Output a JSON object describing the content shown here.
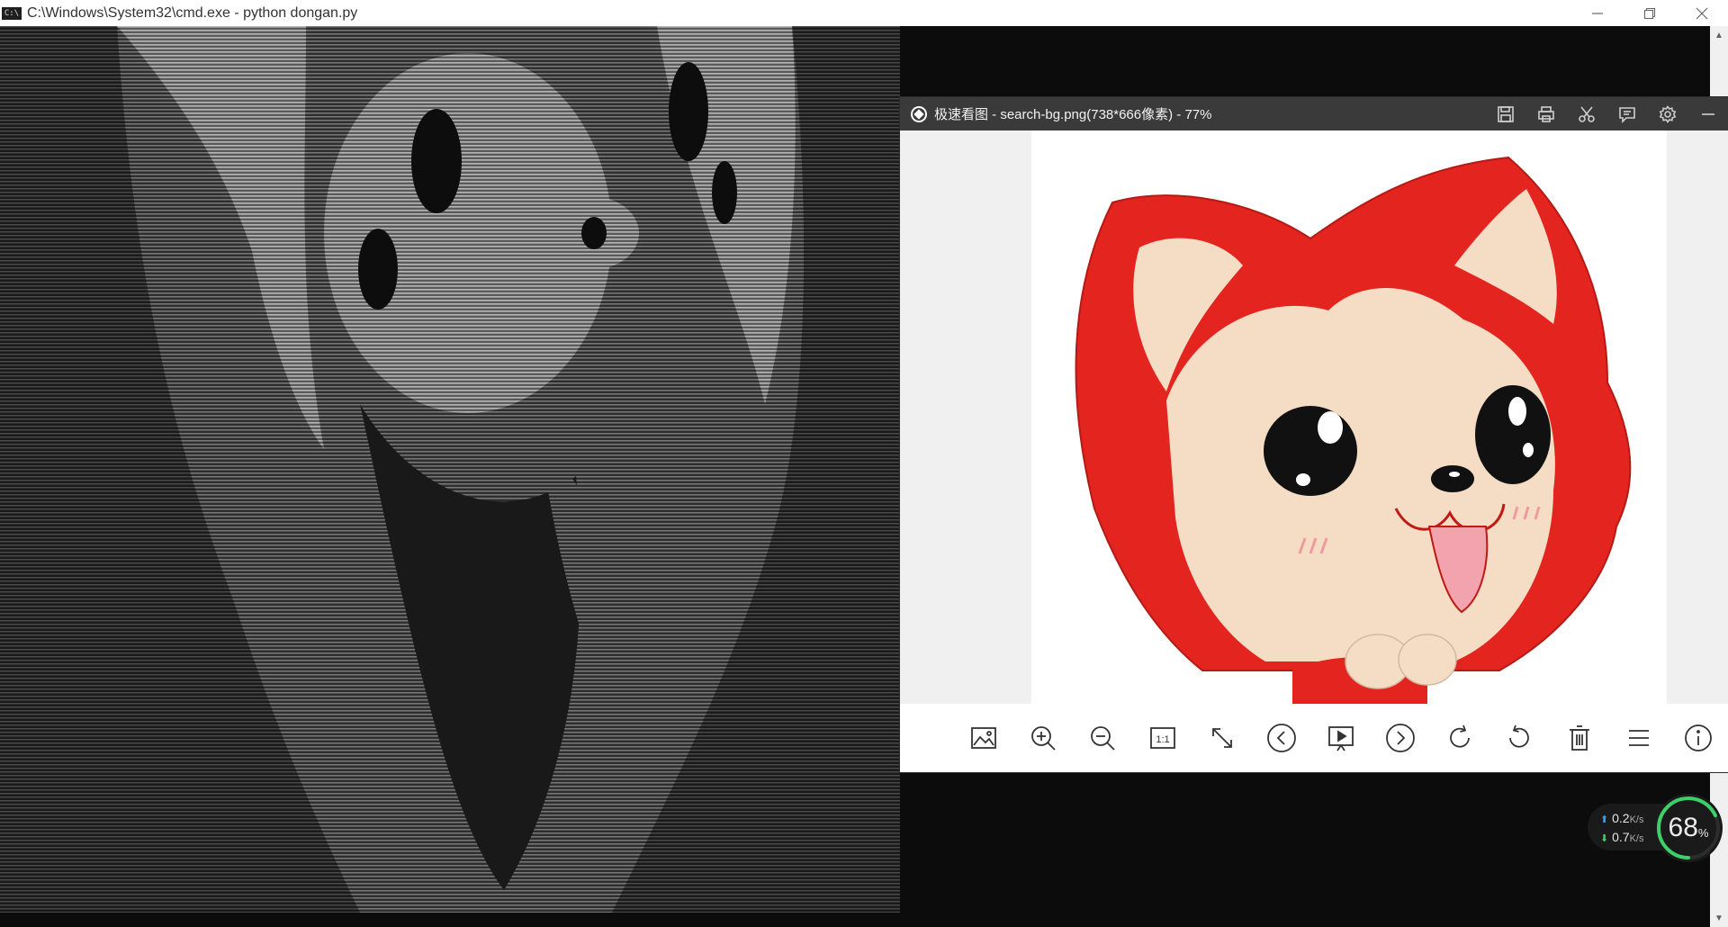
{
  "cmd_window": {
    "title": "C:\\Windows\\System32\\cmd.exe - python  dongan.py",
    "icon_text": "C:\\"
  },
  "viewer": {
    "title": "极速看图 - search-bg.png(738*666像素) - 77%",
    "top_tools": [
      "save-icon",
      "print-icon",
      "cut-icon",
      "comment-icon",
      "settings-icon",
      "minimize-icon"
    ],
    "toolbar": [
      "image-icon",
      "zoom-in-icon",
      "zoom-out-icon",
      "actual-size-icon",
      "fit-window-icon",
      "previous-icon",
      "slideshow-icon",
      "next-icon",
      "rotate-right-icon",
      "rotate-left-icon",
      "delete-icon",
      "menu-icon",
      "info-icon"
    ],
    "actual_size_label": "1:1"
  },
  "net_widget": {
    "upload": "0.2",
    "download": "0.7",
    "unit": "K/s",
    "usage_value": "68",
    "usage_suffix": "%",
    "usage_fraction": 0.68
  },
  "colors": {
    "fox_red": "#e3241f",
    "fox_cream": "#f5dcc4",
    "gauge_green": "#3ccf6a",
    "gauge_blue": "#3aa0ff"
  }
}
